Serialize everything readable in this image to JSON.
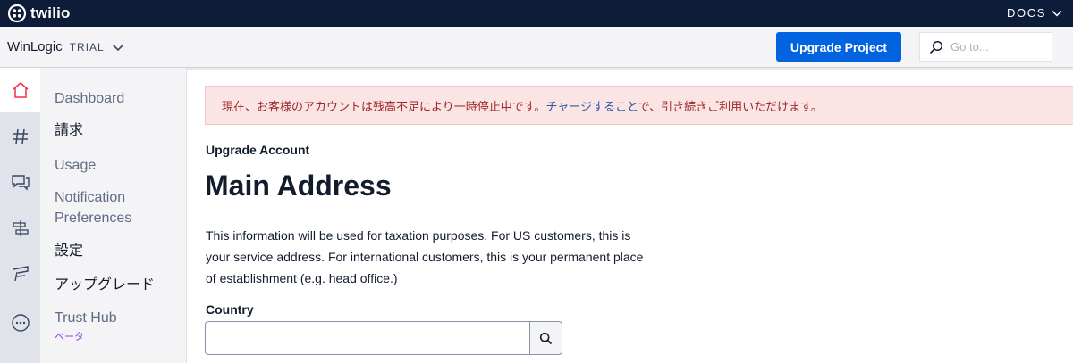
{
  "topbar": {
    "brand": "twilio",
    "docs_label": "DOCS"
  },
  "project": {
    "name": "WinLogic",
    "status": "TRIAL",
    "upgrade_label": "Upgrade Project",
    "search_placeholder": "Go to..."
  },
  "rail": {
    "icons": [
      "home-icon",
      "hash-icon",
      "chat-icon",
      "flow-icon",
      "studio-icon",
      "more-icon"
    ]
  },
  "subnav": {
    "items": [
      {
        "label": "Dashboard"
      },
      {
        "label": "請求"
      },
      {
        "label": "Usage"
      },
      {
        "label": "Notification"
      },
      {
        "label": "Preferences"
      },
      {
        "label": "設定"
      },
      {
        "label": "アップグレード"
      },
      {
        "label": "Trust Hub"
      }
    ],
    "trust_hub_badge": "ベータ"
  },
  "alert": {
    "text_before": "現在、お客様のアカウントは残高不足により一時停止中です。",
    "link": "チャージすること",
    "text_after": "で、引き続きご利用いただけます。"
  },
  "main": {
    "eyebrow": "Upgrade Account",
    "title": "Main Address",
    "description": "This information will be used for taxation purposes. For US customers, this is your service address. For international customers, this is your permanent place of establishment (e.g. head office.)",
    "country_label": "Country",
    "country_value": ""
  },
  "colors": {
    "topbar": "#0d1c38",
    "primary": "#0263e0",
    "alert_bg": "#fbe4e4",
    "alert_text": "#a0282d",
    "link": "#2a54a9",
    "badge": "#9c3be4",
    "active_icon": "#f22f46"
  }
}
